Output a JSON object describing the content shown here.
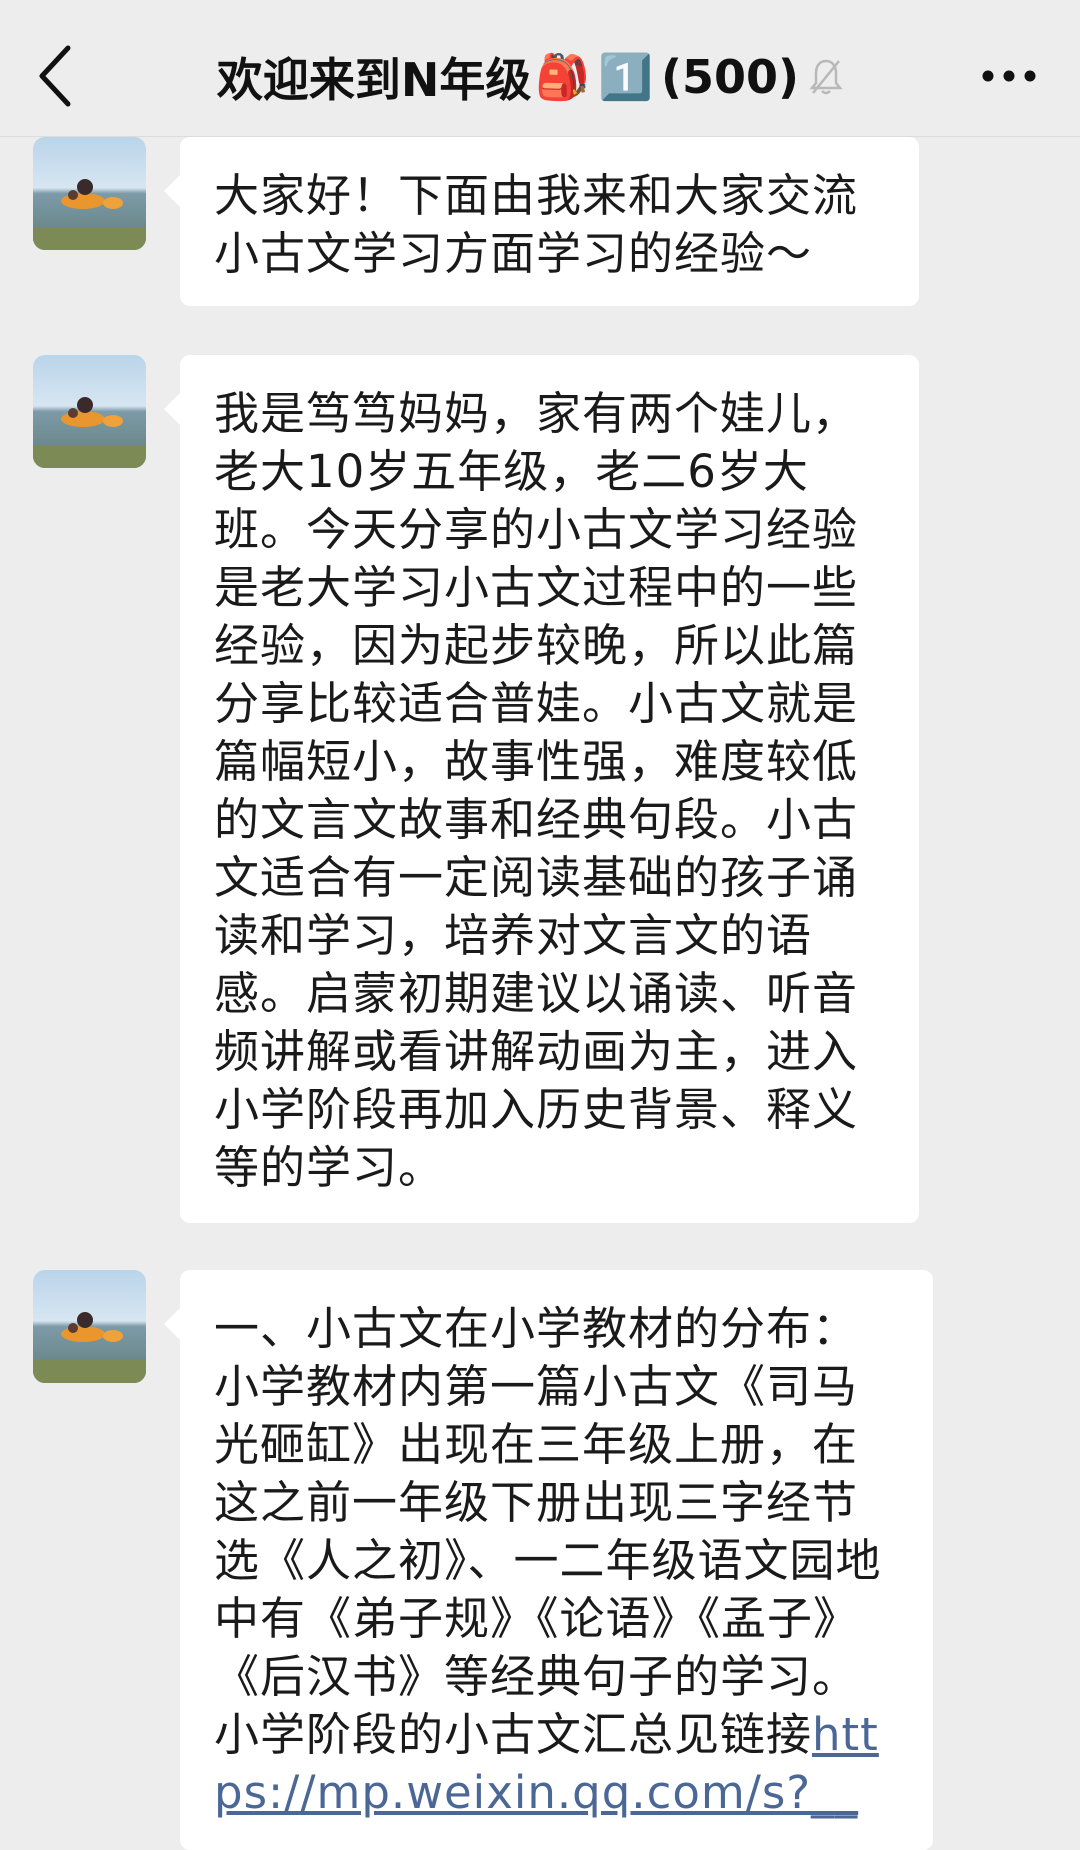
{
  "header": {
    "title": "欢迎来到N年级",
    "emoji_backpack": "🎒",
    "emoji_keycap": "1️⃣",
    "member_count": "(500)",
    "back_icon": "chevron-left-icon",
    "mute_icon": "bell-muted-icon",
    "more_icon": "ellipsis-icon"
  },
  "messages": [
    {
      "sender_avatar": "avatar-photo",
      "text": "大家好！下面由我来和大家交流小古文学习方面学习的经验～"
    },
    {
      "sender_avatar": "avatar-photo",
      "text": "我是笃笃妈妈，家有两个娃儿，老大10岁五年级，老二6岁大班。今天分享的小古文学习经验是老大学习小古文过程中的一些经验，因为起步较晚，所以此篇分享比较适合普娃。小古文就是篇幅短小，故事性强，难度较低的文言文故事和经典句段。小古文适合有一定阅读基础的孩子诵读和学习，培养对文言文的语感。启蒙初期建议以诵读、听音频讲解或看讲解动画为主，进入小学阶段再加入历史背景、释义等的学习。"
    },
    {
      "sender_avatar": "avatar-photo",
      "text": "一、小古文在小学教材的分布：小学教材内第一篇小古文《司马光砸缸》出现在三年级上册，在这之前一年级下册出现三字经节选《人之初》、一二年级语文园地中有《弟子规》《论语》《孟子》《后汉书》等经典句子的学习。小学阶段的小古文汇总见链接",
      "link": "https://mp.weixin.qq.com/s?__"
    }
  ],
  "colors": {
    "background": "#ededed",
    "bubble": "#ffffff",
    "link": "#4a6796"
  }
}
